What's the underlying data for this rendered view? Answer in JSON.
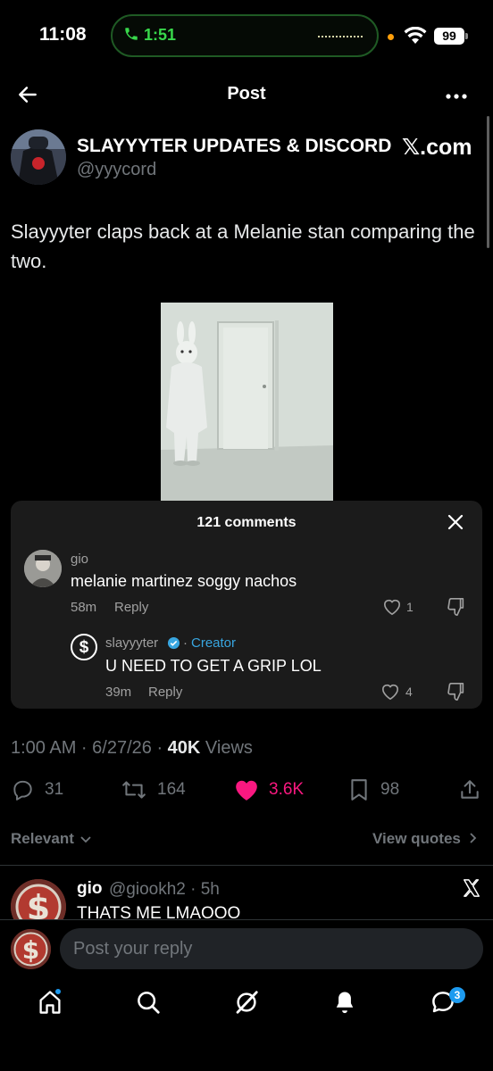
{
  "status_bar": {
    "time": "11:08",
    "call_duration": "1:51",
    "battery": "99",
    "call_color": "#38d74b",
    "orange_dot_color": "#ff9f0a"
  },
  "header": {
    "title": "Post",
    "back_icon": "arrow-left-icon",
    "more_icon": "more-horizontal-icon"
  },
  "post": {
    "author_name": "SLAYYYTER UPDATES & DISCORD",
    "author_handle": "@yyycord",
    "source_badge": "𝕏.com",
    "text": "Slayyyter claps back at a Melanie stan comparing the two.",
    "timestamp": "1:00 AM · 6/27/26 · ",
    "views_count": "40K",
    "views_label": " Views"
  },
  "comments_card": {
    "title": "121 comments",
    "comments": [
      {
        "name": "gio",
        "text": "melanie martinez soggy nachos",
        "time": "58m",
        "reply_label": "Reply",
        "likes": "1"
      },
      {
        "name": "slayyyter",
        "separator": "·",
        "badge": "Creator",
        "text": "U NEED TO GET A GRIP LOL",
        "time": "39m",
        "reply_label": "Reply",
        "likes": "4"
      }
    ]
  },
  "actions": {
    "replies": "31",
    "reposts": "164",
    "likes": "3.6K",
    "bookmarks": "98",
    "like_color": "#f91880"
  },
  "sort": {
    "relevant_label": "Relevant",
    "view_quotes_label": "View quotes"
  },
  "reply_preview": {
    "name": "gio",
    "handle": "@giookh2 · 5h",
    "text": "THATS ME LMAOOO"
  },
  "compose": {
    "placeholder": "Post your reply"
  },
  "bottom_nav": {
    "items": [
      "home-icon",
      "search-icon",
      "grok-icon",
      "notifications-icon",
      "messages-icon"
    ],
    "messages_badge": "3",
    "accent": "#1d9bf0"
  }
}
